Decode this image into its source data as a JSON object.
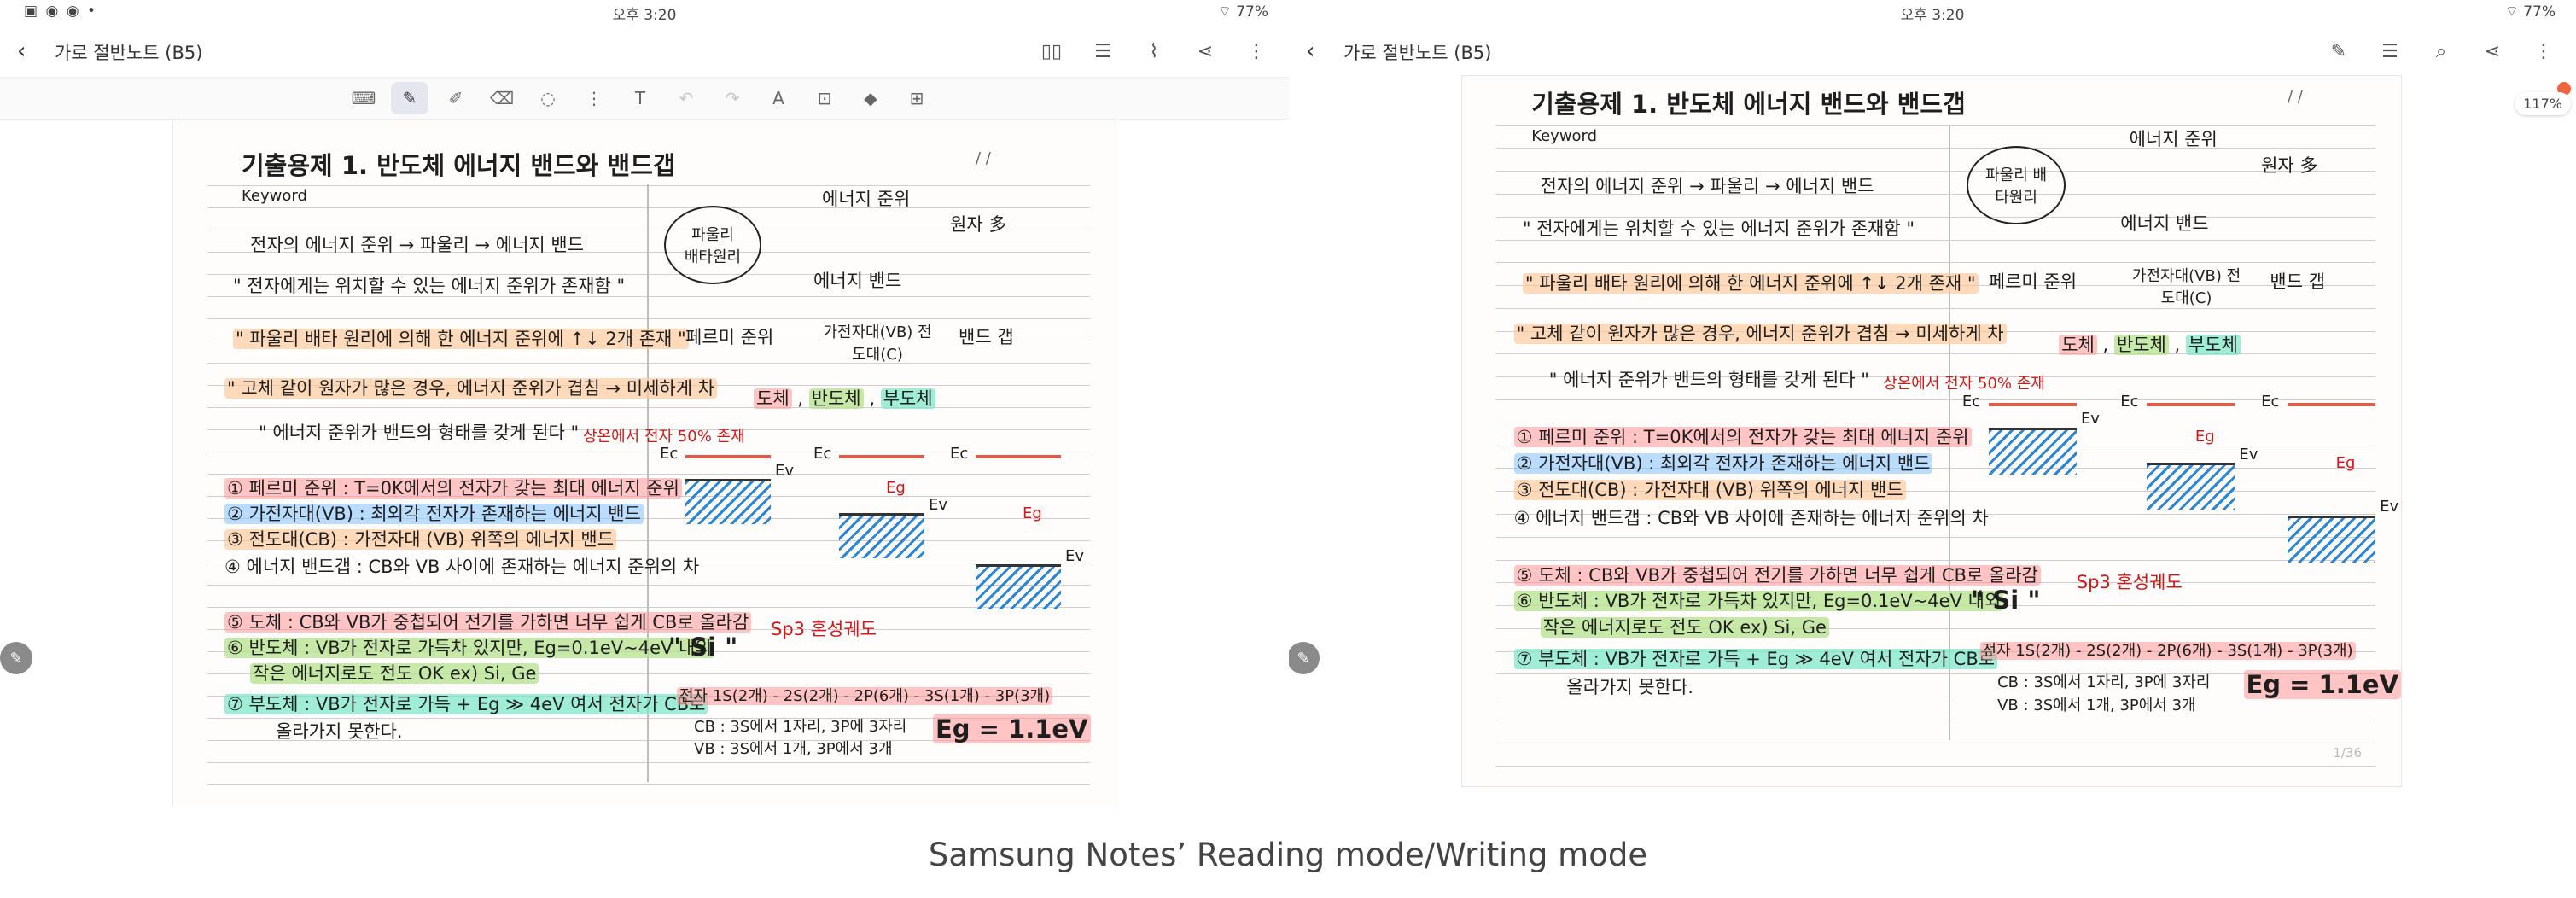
{
  "status": {
    "time": "오후 3:20",
    "battery": "77%",
    "left_icons": "▣ ◉ ◉ •"
  },
  "app": {
    "back_glyph": "‹",
    "title": "가로 절반노트 (B5)",
    "icons_left": [
      "book-icon",
      "list-icon",
      "clip-icon",
      "share-icon",
      "more-icon"
    ],
    "icons_right": [
      "edit-icon",
      "list-icon",
      "search-icon",
      "share-icon",
      "more-icon"
    ],
    "zoom": "117%",
    "page_number": "1/36"
  },
  "toolbar": {
    "tools": [
      {
        "name": "keyboard-icon",
        "glyph": "⌨",
        "state": "normal"
      },
      {
        "name": "pen-icon",
        "glyph": "✎",
        "state": "active"
      },
      {
        "name": "highlighter-icon",
        "glyph": "✐",
        "state": "normal"
      },
      {
        "name": "eraser-icon",
        "glyph": "⌫",
        "state": "normal"
      },
      {
        "name": "lasso-icon",
        "glyph": "◌",
        "state": "normal"
      },
      {
        "name": "shape-icon",
        "glyph": "⋮",
        "state": "normal"
      },
      {
        "name": "text-icon",
        "glyph": "T",
        "state": "normal"
      },
      {
        "name": "undo-icon",
        "glyph": "↶",
        "state": "disabled"
      },
      {
        "name": "redo-icon",
        "glyph": "↷",
        "state": "disabled"
      },
      {
        "name": "spell-icon",
        "glyph": "A",
        "state": "normal"
      },
      {
        "name": "ocr-icon",
        "glyph": "⊡",
        "state": "normal"
      },
      {
        "name": "fill-icon",
        "glyph": "◆",
        "state": "normal"
      },
      {
        "name": "more-tool-icon",
        "glyph": "⊞",
        "state": "normal"
      }
    ]
  },
  "note": {
    "heading": "기출용제 1. 반도체 에너지 밴드와 밴드갭",
    "keyword": "Keyword",
    "date_marks": "/      /",
    "line1": "전자의 에너지 준위 → 파울리 → 에너지 밴드",
    "line2": "\" 전자에게는 위치할 수 있는 에너지 준위가 존재함 \"",
    "line3": "\" 파울리 배타 원리에 의해 한 에너지 준위에 ↑↓ 2개 존재 \"",
    "line4": "\" 고체 같이 원자가 많은 경우, 에너지 준위가 겹침 → 미세하게 차",
    "line5": "\" 에너지 준위가 밴드의 형태를 갖게 된다 \"",
    "def1": "① 페르미 준위 : T=0K에서의 전자가 갖는 최대 에너지 준위",
    "def2": "② 가전자대(VB) : 최외각 전자가 존재하는 에너지 밴드",
    "def3": "③ 전도대(CB) : 가전자대 (VB) 위쪽의 에너지 밴드",
    "def4": "④ 에너지 밴드갭 : CB와 VB 사이에 존재하는 에너지 준위의 차",
    "def5": "⑤ 도체 : CB와 VB가 중첩되어 전기를 가하면 너무 쉽게 CB로 올라감",
    "def6": "⑥ 반도체 : VB가 전자로 가득차 있지만, Eg=0.1eV~4eV 내외",
    "def6b": "작은 에너지로도 전도 OK   ex) Si, Ge",
    "def7": "⑦ 부도체 : VB가 전자로 가득 + Eg ≫ 4eV 여서 전자가 CB로",
    "def7b": "올라가지 못한다.",
    "diagram": {
      "top": "에너지 준위",
      "pauli_circle": "파울리 배타원리",
      "atom": "원자 多",
      "band": "에너지 밴드",
      "fermi": "페르미 준위",
      "vb_cb": "가전자대(VB) 전도대(C)",
      "gap": "밴드 갭",
      "materials": [
        "도체",
        "반도체",
        "부도체"
      ],
      "ec": "Ec",
      "ev": "Ev",
      "eg": "Eg",
      "red_note": "상온에서 전자 50% 존재",
      "sp3": "Sp3 혼성궤도",
      "si": "\" Si \"",
      "config": "전자 1S(2개) - 2S(2개) - 2P(6개) - 3S(1개) - 3P(3개)",
      "cb_note": "CB : 3S에서 1자리, 3P에 3자리",
      "vb_note": "VB : 3S에서 1개, 3P에서 3개",
      "eg_value": "Eg = 1.1eV"
    }
  },
  "caption": "Samsung Notes’ Reading mode/Writing mode"
}
